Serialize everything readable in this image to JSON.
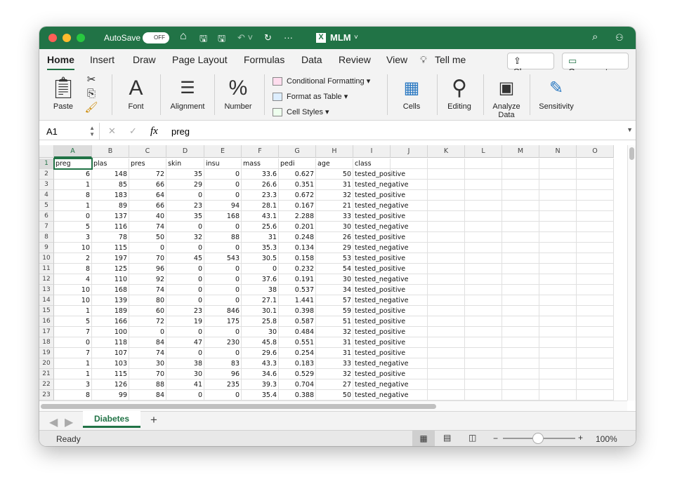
{
  "titlebar": {
    "autosave": "AutoSave",
    "toggle": "OFF",
    "filename": "MLM",
    "accent": "#217346"
  },
  "ribbon_tabs": [
    "Home",
    "Insert",
    "Draw",
    "Page Layout",
    "Formulas",
    "Data",
    "Review",
    "View"
  ],
  "tell_me": "Tell me",
  "share": "Share",
  "comments": "Comments",
  "ribbon": {
    "paste": "Paste",
    "font": "Font",
    "alignment": "Alignment",
    "number": "Number",
    "conditional_formatting": "Conditional Formatting",
    "format_as_table": "Format as Table",
    "cell_styles": "Cell Styles",
    "cells": "Cells",
    "editing": "Editing",
    "analyze1": "Analyze",
    "analyze2": "Data",
    "sensitivity": "Sensitivity"
  },
  "formula_bar": {
    "name_box": "A1",
    "fx": "fx",
    "value": "preg"
  },
  "columns": [
    "A",
    "B",
    "C",
    "D",
    "E",
    "F",
    "G",
    "H",
    "I",
    "J",
    "K",
    "L",
    "M",
    "N",
    "O"
  ],
  "headers": [
    "preg",
    "plas",
    "pres",
    "skin",
    "insu",
    "mass",
    "pedi",
    "age",
    "class"
  ],
  "rows": [
    [
      "6",
      "148",
      "72",
      "35",
      "0",
      "33.6",
      "0.627",
      "50",
      "tested_positive"
    ],
    [
      "1",
      "85",
      "66",
      "29",
      "0",
      "26.6",
      "0.351",
      "31",
      "tested_negative"
    ],
    [
      "8",
      "183",
      "64",
      "0",
      "0",
      "23.3",
      "0.672",
      "32",
      "tested_positive"
    ],
    [
      "1",
      "89",
      "66",
      "23",
      "94",
      "28.1",
      "0.167",
      "21",
      "tested_negative"
    ],
    [
      "0",
      "137",
      "40",
      "35",
      "168",
      "43.1",
      "2.288",
      "33",
      "tested_positive"
    ],
    [
      "5",
      "116",
      "74",
      "0",
      "0",
      "25.6",
      "0.201",
      "30",
      "tested_negative"
    ],
    [
      "3",
      "78",
      "50",
      "32",
      "88",
      "31",
      "0.248",
      "26",
      "tested_positive"
    ],
    [
      "10",
      "115",
      "0",
      "0",
      "0",
      "35.3",
      "0.134",
      "29",
      "tested_negative"
    ],
    [
      "2",
      "197",
      "70",
      "45",
      "543",
      "30.5",
      "0.158",
      "53",
      "tested_positive"
    ],
    [
      "8",
      "125",
      "96",
      "0",
      "0",
      "0",
      "0.232",
      "54",
      "tested_positive"
    ],
    [
      "4",
      "110",
      "92",
      "0",
      "0",
      "37.6",
      "0.191",
      "30",
      "tested_negative"
    ],
    [
      "10",
      "168",
      "74",
      "0",
      "0",
      "38",
      "0.537",
      "34",
      "tested_positive"
    ],
    [
      "10",
      "139",
      "80",
      "0",
      "0",
      "27.1",
      "1.441",
      "57",
      "tested_negative"
    ],
    [
      "1",
      "189",
      "60",
      "23",
      "846",
      "30.1",
      "0.398",
      "59",
      "tested_positive"
    ],
    [
      "5",
      "166",
      "72",
      "19",
      "175",
      "25.8",
      "0.587",
      "51",
      "tested_positive"
    ],
    [
      "7",
      "100",
      "0",
      "0",
      "0",
      "30",
      "0.484",
      "32",
      "tested_positive"
    ],
    [
      "0",
      "118",
      "84",
      "47",
      "230",
      "45.8",
      "0.551",
      "31",
      "tested_positive"
    ],
    [
      "7",
      "107",
      "74",
      "0",
      "0",
      "29.6",
      "0.254",
      "31",
      "tested_positive"
    ],
    [
      "1",
      "103",
      "30",
      "38",
      "83",
      "43.3",
      "0.183",
      "33",
      "tested_negative"
    ],
    [
      "1",
      "115",
      "70",
      "30",
      "96",
      "34.6",
      "0.529",
      "32",
      "tested_positive"
    ],
    [
      "3",
      "126",
      "88",
      "41",
      "235",
      "39.3",
      "0.704",
      "27",
      "tested_negative"
    ],
    [
      "8",
      "99",
      "84",
      "0",
      "0",
      "35.4",
      "0.388",
      "50",
      "tested_negative"
    ]
  ],
  "sheet_tab": "Diabetes",
  "add_sheet": "+",
  "status": {
    "ready": "Ready",
    "zoom": "100%",
    "minus": "−",
    "plus": "+",
    "zoom_level_percent": 100
  }
}
